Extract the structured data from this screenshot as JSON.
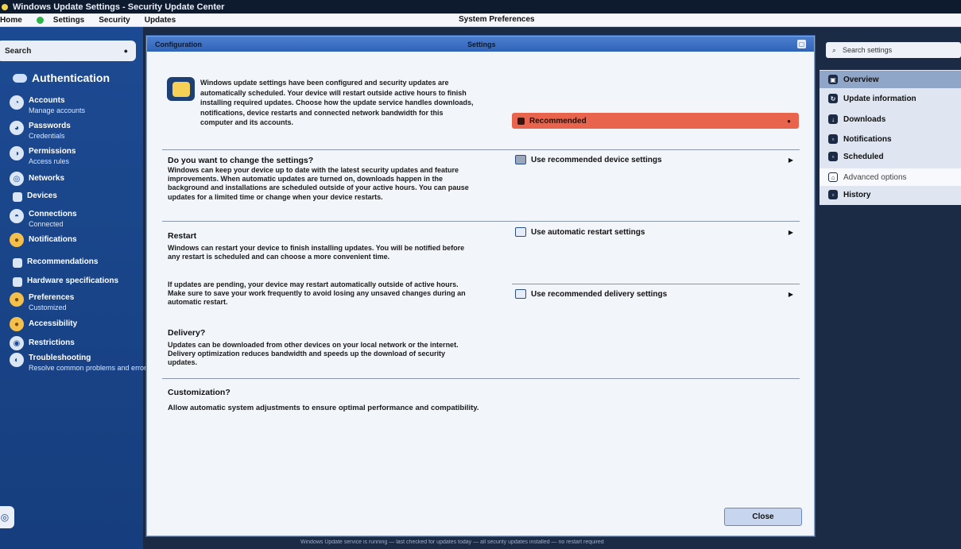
{
  "topbar": {
    "title": "Windows Update Settings - Security Update Center"
  },
  "menubar": {
    "items": [
      "Home",
      "Settings",
      "Security",
      "Updates"
    ],
    "center_title": "System Preferences"
  },
  "sidebar": {
    "search_label": "Search",
    "title": "Authentication",
    "items": [
      {
        "label": "Accounts",
        "sub": "Manage accounts"
      },
      {
        "label": "Passwords",
        "sub": "Credentials"
      },
      {
        "label": "Permissions",
        "sub": "Access rules"
      },
      {
        "label": "Networks",
        "sub": ""
      },
      {
        "label": "Devices",
        "sub": ""
      },
      {
        "label": "Connections",
        "sub": "Connected"
      },
      {
        "label": "Notifications",
        "sub": ""
      },
      {
        "label": "Recommendations",
        "sub": ""
      },
      {
        "label": "Hardware specifications",
        "sub": ""
      },
      {
        "label": "Preferences",
        "sub": "Customized"
      },
      {
        "label": "Accessibility",
        "sub": ""
      },
      {
        "label": "Restrictions",
        "sub": ""
      },
      {
        "label": "Troubleshooting",
        "sub": "Resolve common problems and errors"
      }
    ]
  },
  "dialog": {
    "title_left": "Configuration",
    "title_center": "Settings",
    "intro": "Windows update settings have been configured and security updates are automatically scheduled. Your device will restart outside active hours to finish installing required updates. Choose how the update service handles downloads, notifications, device restarts and connected network bandwidth for this computer and its accounts.",
    "dropdown_label": "Recommended",
    "section1_title": "Do you want to change the settings?",
    "section1_text": "Windows can keep your device up to date with the latest security updates and feature improvements. When automatic updates are turned on, downloads happen in the background and installations are scheduled outside of your active hours. You can pause updates for a limited time or change when your device restarts.",
    "section2_title": "Restart",
    "section2_text_a": "Windows can restart your device to finish installing updates. You will be notified before any restart is scheduled and can choose a more convenient time.",
    "section2_text_b": "If updates are pending, your device may restart automatically outside of active hours. Make sure to save your work frequently to avoid losing any unsaved changes during an automatic restart.",
    "section3_title": "Delivery?",
    "section3_text": "Updates can be downloaded from other devices on your local network or the internet. Delivery optimization reduces bandwidth and speeds up the download of security updates.",
    "section4_title": "Customization?",
    "section4_text": "Allow automatic system adjustments to ensure optimal performance and compatibility.",
    "option1": "Use recommended device settings",
    "option2": "Use automatic restart settings",
    "option3": "Use recommended delivery settings",
    "ok_label": "Close"
  },
  "rpanel": {
    "search_label": "Search settings",
    "items": [
      {
        "label": "Overview",
        "icon": "grid-icon"
      },
      {
        "label": "Update information",
        "icon": "refresh-icon"
      },
      {
        "label": "Downloads",
        "icon": "download-icon"
      },
      {
        "label": "Notifications",
        "icon": "bell-icon"
      },
      {
        "label": "Scheduled",
        "icon": "clock-icon"
      },
      {
        "label": "Advanced options",
        "icon": "lock-icon"
      },
      {
        "label": "History",
        "icon": "history-icon"
      }
    ]
  },
  "footer": {
    "text": "Windows Update service is running — last checked for updates today — all security updates installed — no restart required"
  }
}
